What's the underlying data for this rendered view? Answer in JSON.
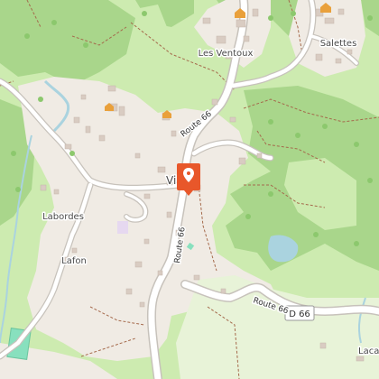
{
  "map": {
    "place_labels": {
      "les_ventoux": "Les Ventoux",
      "salettes": "Salettes",
      "vi": "Vi",
      "labordes": "Labordes",
      "lafon": "Lafon",
      "laca": "Laca"
    },
    "road_labels": {
      "route66_upper": "Route 66",
      "route66_middle": "Route 66",
      "route66_lower": "Route 66",
      "d66_shield": "D 66"
    },
    "marker": {
      "icon": "map-pin-icon",
      "color": "#e8572a"
    },
    "colors": {
      "forest": "#a9d68b",
      "meadow": "#cdebb0",
      "residential": "#f0ebe4",
      "water": "#aad3df",
      "road": "#ffffff",
      "road_casing": "#c7c2bb",
      "pitch": "#88e0be",
      "building": "#d9ccc2",
      "path": "#a56a4c"
    }
  }
}
